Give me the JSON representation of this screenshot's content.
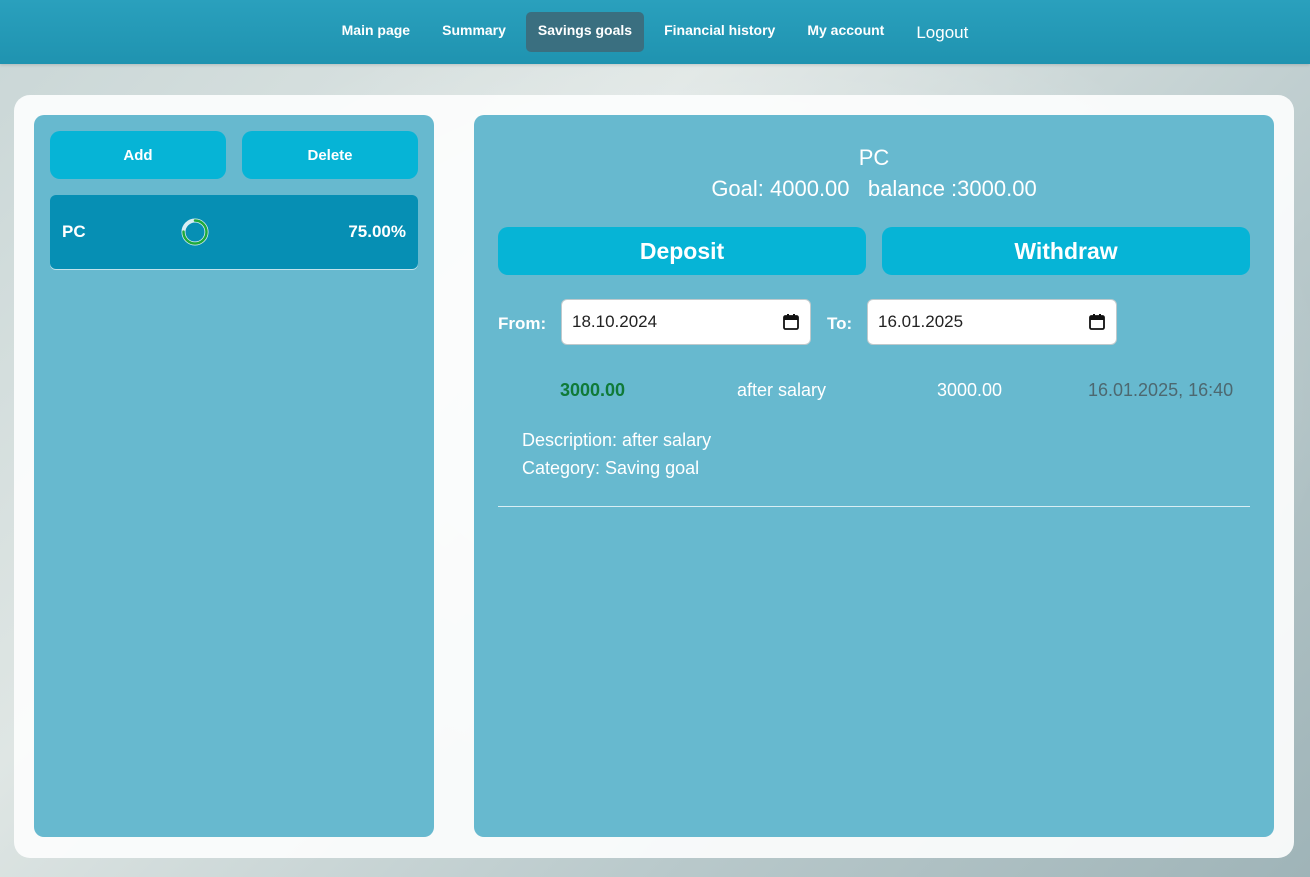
{
  "nav": {
    "items": [
      {
        "label": "Main page",
        "active": false
      },
      {
        "label": "Summary",
        "active": false
      },
      {
        "label": "Savings goals",
        "active": true
      },
      {
        "label": "Financial history",
        "active": false
      },
      {
        "label": "My account",
        "active": false
      }
    ],
    "logout_label": "Logout"
  },
  "sidebar": {
    "add_label": "Add",
    "delete_label": "Delete",
    "goals": [
      {
        "name": "PC",
        "percent_label": "75.00%",
        "progress": 0.75,
        "progress_icon": "progress-ring-icon"
      }
    ]
  },
  "detail": {
    "title": "PC",
    "summary": "Goal: 4000.00   balance :3000.00",
    "deposit_label": "Deposit",
    "withdraw_label": "Withdraw",
    "from_label": "From:",
    "from_value": "18.10.2024",
    "to_label": "To:",
    "to_value": "16.01.2025",
    "calendar_icon": "calendar-icon",
    "transactions": [
      {
        "amount": "3000.00",
        "name": "after salary",
        "balance": "3000.00",
        "date": "16.01.2025, 16:40",
        "description": "Description: after salary",
        "category": "Category: Saving goal"
      }
    ]
  },
  "colors": {
    "topbar": "#2aa0bd",
    "panel": "#67b9cf",
    "button": "#06b4d6",
    "goal_item": "#068fb4",
    "nav_active": "#3a6f80",
    "amount_positive": "#0f7a38",
    "progress_ring": "#1faa3b"
  }
}
